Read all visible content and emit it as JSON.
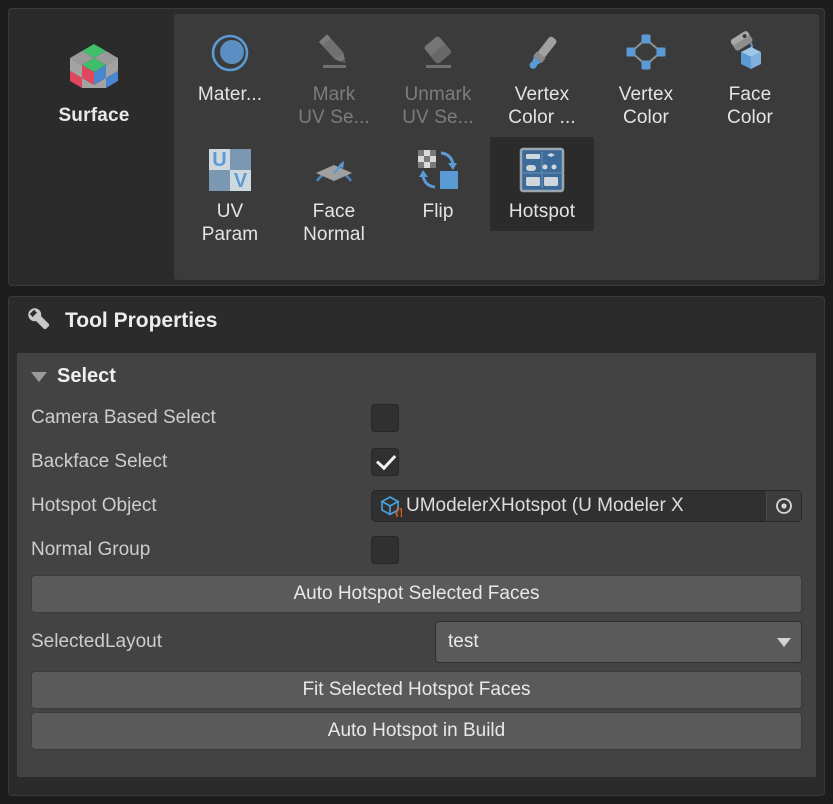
{
  "toolbar": {
    "mode": {
      "label": "Surface",
      "icon": "rubiks-cube-icon"
    },
    "tools": [
      {
        "label": "Mater...",
        "icon": "material-sphere-icon",
        "state": "enabled"
      },
      {
        "label": "Mark\nUV Se...",
        "icon": "pencil-icon",
        "state": "disabled"
      },
      {
        "label": "Unmark\nUV Se...",
        "icon": "eraser-icon",
        "state": "disabled"
      },
      {
        "label": "Vertex\nColor ...",
        "icon": "paint-brush-icon",
        "state": "enabled"
      },
      {
        "label": "Vertex\nColor",
        "icon": "vertex-diamond-icon",
        "state": "enabled"
      },
      {
        "label": "Face\nColor",
        "icon": "paint-bucket-cube-icon",
        "state": "enabled"
      },
      {
        "label": "UV\nParam",
        "icon": "uv-checker-icon",
        "state": "enabled"
      },
      {
        "label": "Face\nNormal",
        "icon": "face-normal-icon",
        "state": "enabled"
      },
      {
        "label": "Flip",
        "icon": "flip-icon",
        "state": "enabled"
      },
      {
        "label": "Hotspot",
        "icon": "hotspot-atlas-icon",
        "state": "selected"
      }
    ]
  },
  "properties": {
    "header": {
      "title": "Tool Properties",
      "icon": "wrench-icon"
    },
    "section": {
      "label": "Select",
      "expanded": true
    },
    "rows": [
      {
        "label": "Camera Based Select",
        "type": "checkbox",
        "checked": false
      },
      {
        "label": "Backface Select",
        "type": "checkbox",
        "checked": true
      },
      {
        "label": "Hotspot Object",
        "type": "object",
        "value": "UModelerXHotspot (U Modeler X",
        "picker_icon": "target-picker-icon",
        "object_icon": "blueprint-cube-icon"
      },
      {
        "label": "Normal Group",
        "type": "checkbox",
        "checked": false
      }
    ],
    "auto_hotspot_selected_faces_label": "Auto Hotspot Selected Faces",
    "selected_layout_label": "SelectedLayout",
    "selected_layout_value": "test",
    "fit_selected_hotspot_faces_label": "Fit Selected Hotspot Faces",
    "auto_hotspot_in_build_label": "Auto Hotspot in Build"
  },
  "colors": {
    "window_bg": "#1d1d1d",
    "panel_bg": "#2b2b2b",
    "grid_bg": "#3b3b3b",
    "body_bg": "#434343",
    "button_bg": "#5a5a5a",
    "accent_blue": "#5b9bd5",
    "accent_orange": "#e06020",
    "text": "#e4e4e4",
    "text_disabled": "#7d7d7d"
  }
}
